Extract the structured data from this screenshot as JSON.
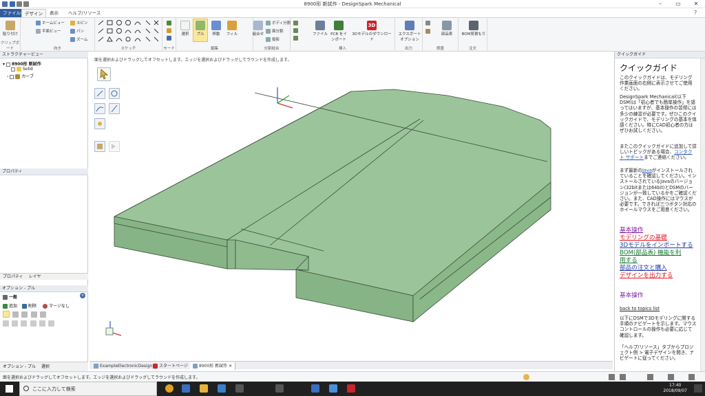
{
  "window": {
    "title": "8900形 新試作 - DesignSpark Mechanical",
    "help_icon": "?"
  },
  "tabs": [
    "ファイル(F)",
    "デザイン",
    "表示",
    "ヘルプ/リソース"
  ],
  "ribbon": {
    "clipboard": {
      "paste": "貼り付け",
      "label": "クリップボード"
    },
    "orient": {
      "home": "ホームビュー",
      "plane": "平面ビュー",
      "spin": "スピン",
      "pan": "パン",
      "zoom": "ズーム",
      "label": "向き"
    },
    "sketch": {
      "label": "スケッチ"
    },
    "mode": {
      "label": "モード"
    },
    "edit": {
      "select": "選択",
      "pull": "プル",
      "move": "移動",
      "fill": "フィル",
      "label": "編集"
    },
    "intersect": {
      "combine": "組合せ",
      "split_body": "ボディ分割",
      "split_face": "面分割",
      "project": "投影",
      "label": "分割結合"
    },
    "insert": {
      "file": "ファイル",
      "pcb": "PCB をイ\nンポート",
      "three_d": "3Dモデルのダウンロード",
      "label": "挿入"
    },
    "output": {
      "export": "エクスポート\nオプション",
      "label": "出力"
    },
    "investigate": {
      "parts": "部品表",
      "label": "調査"
    },
    "order": {
      "bom": "BOM見積もり",
      "label": "注文"
    }
  },
  "structure": {
    "header": "ストラクチャービュー",
    "root": "8900形 新試作",
    "items": [
      "Solid",
      "カーブ"
    ]
  },
  "properties": {
    "header": "プロパティ",
    "tabs": [
      "プロパティ",
      "レイヤ"
    ]
  },
  "options": {
    "header": "オプション - プル",
    "section": "一般",
    "add": "追加",
    "remove": "削除",
    "no_merge": "マージなし"
  },
  "left_bottom_tabs": [
    "オプション - プル",
    "選択"
  ],
  "viewport": {
    "hint": "面を選択およびドラッグしてオフセットします。エッジを選択およびドラッグしてラウンドを作成します。"
  },
  "doc_tabs": [
    "ExampleElectronicDesign",
    "スタートページ",
    "8900形 新試作"
  ],
  "guide": {
    "header": "クイックガイド",
    "title": "クイックガイド",
    "p1": "このクイックガイドは、モデリング作業画面の右側に表示させてご使用ください。",
    "p2": "DesignSpark Mechanical(以下DSM)は「初心者でも簡単操作」を謳ってはいますが、基本操作の習得には多少の練習が必要です。ぜひこのクイックガイドで、モデリングの基本を体感ください。特にCAD初心者の方はぜひお試しください。",
    "p3a": "またこのクイックガイドに追加して詳しいトピックがある場合、",
    "p3link": "コンタクト サポート",
    "p3b": "までご連絡ください。",
    "p4a": "まず最新の",
    "p4link": "Java",
    "p4b": "がインストールされていることを確認してください。インストールされているJavaのバージョン(32bitまたは64bit)とDSMのバージョンが一致しているかをご確認ください。また、CAD操作にはマウスが必要です。できれば三つボタン対応のホイールマウスをご用意ください。",
    "links": [
      {
        "text": "基本操作",
        "color": "#7a1ea1"
      },
      {
        "text": "モデリングの基礎",
        "color": "#e0141e"
      },
      {
        "text": "3Dモデルをインポートする",
        "color": "#1f3aa6"
      },
      {
        "text": "BOM(部品表) 機能を利",
        "color": "#127a2c"
      },
      {
        "text": "用する",
        "color": "#127a2c"
      },
      {
        "text": "部品の注文と購入",
        "color": "#1f3aa6"
      },
      {
        "text": "デザインを出力する",
        "color": "#e0141e"
      }
    ],
    "section": "基本操作",
    "back": "back to topics list",
    "p5": "以下にDSMで3Dモデリングに関する手順のナビゲートを示します。マウスコントロールの操作も必要に応じて確認します。",
    "p6": "「ヘルプ/リソース」タブからプロジェクト例 > 電子デザインを開き、ナビゲートに従ってください。"
  },
  "status": {
    "text": "面を選択およびドラッグしてオフセットします。エッジを選択およびドラッグしてラウンドを作成します。"
  },
  "taskbar": {
    "search": "ここに入力して検索",
    "time": "17:40",
    "date": "2018/09/07"
  },
  "colors": {
    "model_face": "#9cc49a",
    "model_side": "#87b486",
    "file_tab": "#2f5d9e",
    "pull_active": "#fde79a"
  }
}
